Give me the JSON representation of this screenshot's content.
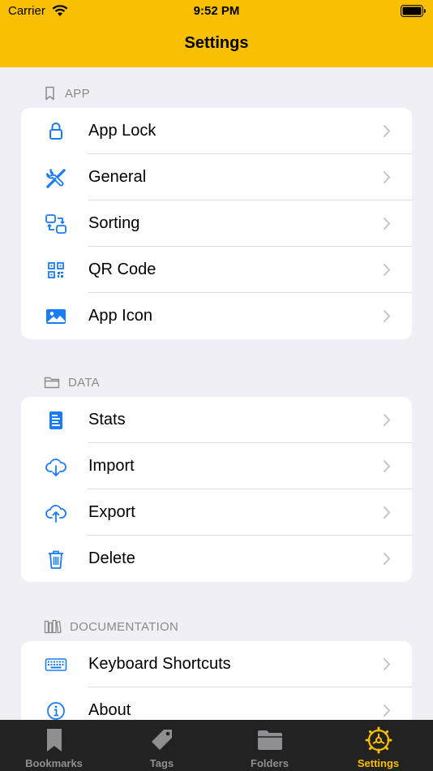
{
  "status_bar": {
    "carrier": "Carrier",
    "time": "9:52 PM"
  },
  "nav": {
    "title": "Settings"
  },
  "sections": {
    "app": {
      "header": "APP",
      "items": [
        {
          "label": "App Lock",
          "icon": "lock-icon"
        },
        {
          "label": "General",
          "icon": "wrench-screwdriver-icon"
        },
        {
          "label": "Sorting",
          "icon": "sort-arrows-icon"
        },
        {
          "label": "QR Code",
          "icon": "qr-code-icon"
        },
        {
          "label": "App Icon",
          "icon": "photo-icon"
        }
      ]
    },
    "data": {
      "header": "DATA",
      "items": [
        {
          "label": "Stats",
          "icon": "stats-document-icon"
        },
        {
          "label": "Import",
          "icon": "cloud-download-icon"
        },
        {
          "label": "Export",
          "icon": "cloud-upload-icon"
        },
        {
          "label": "Delete",
          "icon": "trash-icon"
        }
      ]
    },
    "documentation": {
      "header": "DOCUMENTATION",
      "items": [
        {
          "label": "Keyboard Shortcuts",
          "icon": "keyboard-icon"
        },
        {
          "label": "About",
          "icon": "info-icon"
        }
      ]
    }
  },
  "tabbar": {
    "tabs": [
      {
        "label": "Bookmarks",
        "icon": "bookmark-icon"
      },
      {
        "label": "Tags",
        "icon": "tag-icon"
      },
      {
        "label": "Folders",
        "icon": "folder-icon"
      },
      {
        "label": "Settings",
        "icon": "gear-icon",
        "active": true
      }
    ]
  },
  "colors": {
    "accent": "#f8c000",
    "icon_blue": "#1a7cf5",
    "background": "#f0eff5",
    "tabbar": "#222222"
  }
}
